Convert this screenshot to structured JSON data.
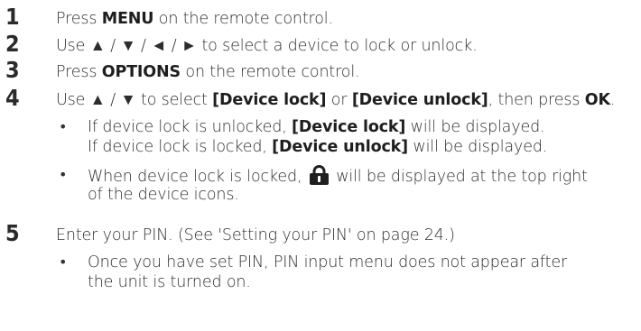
{
  "steps": [
    {
      "number": "1",
      "lines": [
        "Press |MENU| on the remote control."
      ]
    },
    {
      "number": "2",
      "lines": [
        "Use ▲ / ▼ / ◄ / ► to select a device to lock or unlock."
      ]
    },
    {
      "number": "3",
      "lines": [
        "Press |OPTIONS| on the remote control."
      ]
    },
    {
      "number": "4",
      "lines": [
        "Use ▲ / ▼ to select |[Device lock]| or |[Device unlock]|, then press |OK|."
      ]
    },
    {
      "number": "5",
      "lines": [
        "Enter your PIN. (See 'Setting your PIN' on page 24.)"
      ]
    }
  ],
  "step4_bullets": [
    {
      "lines": [
        "If device lock is unlocked, |[Device lock]| will be displayed.",
        "If device lock is locked, |[Device unlock]| will be displayed."
      ]
    },
    {
      "lines": [
        "When device lock is locked, {lock} will be displayed at the top right",
        "of the device icons."
      ]
    }
  ],
  "step5_bullets": [
    {
      "lines": [
        "Once you have set PIN, PIN input menu does not appear after",
        "the unit is turned on."
      ]
    }
  ],
  "bullet_glyph": "•",
  "icon": {
    "name": "lock-icon",
    "color": "#1f1f1f"
  },
  "colors": {
    "text": "#2d2d2d",
    "bold": "#1e1e1e"
  }
}
